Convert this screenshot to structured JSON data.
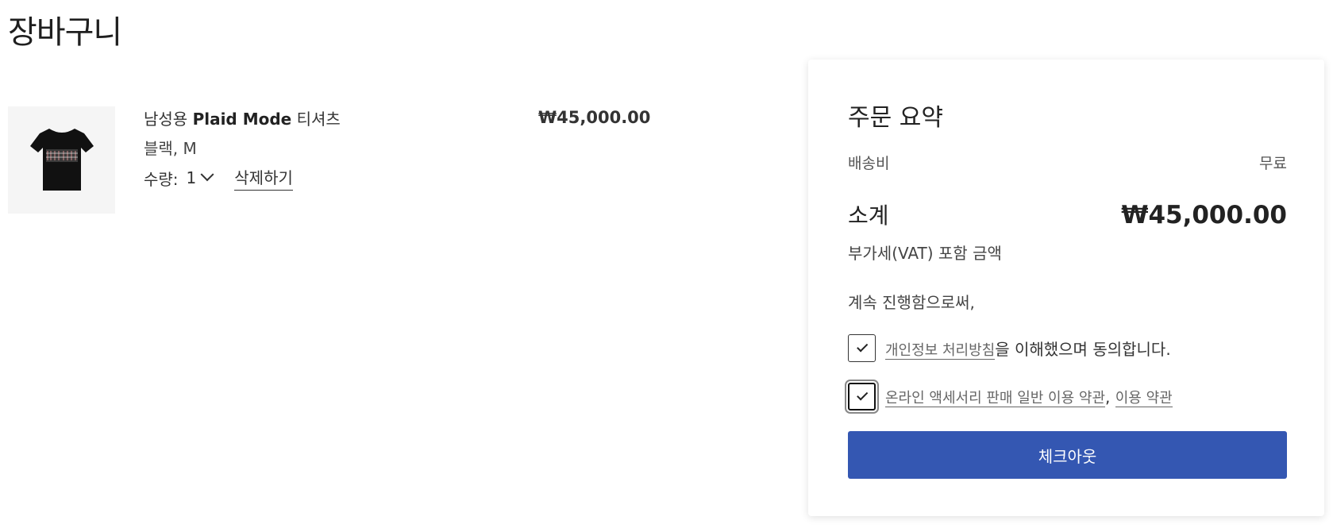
{
  "page": {
    "title": "장바구니"
  },
  "cart": {
    "items": [
      {
        "name_prefix": "남성용 ",
        "name_bold": "Plaid Mode",
        "name_suffix": " 티셔츠",
        "variant": "블랙, M",
        "qty_label": "수량:",
        "qty_value": "1",
        "delete_label": "삭제하기",
        "price": "₩45,000.00",
        "image_icon": "tshirt-black"
      }
    ]
  },
  "summary": {
    "title": "주문 요약",
    "shipping_label": "배송비",
    "shipping_value": "무료",
    "subtotal_label": "소계",
    "subtotal_value": "₩45,000.00",
    "vat_note": "부가세(VAT) 포함 금액",
    "continue_note": "계속 진행함으로써,",
    "agree1": {
      "link": "개인정보 처리방침",
      "text": "을 이해했으며 동의합니다.",
      "checked": true
    },
    "agree2": {
      "link1": "온라인 액세서리 판매 일반 이용 약관",
      "separator": ",",
      "link2": "이용 약관",
      "checked": true
    },
    "checkout_label": "체크아웃",
    "colors": {
      "button": "#3457b2",
      "button_text": "#ffffff"
    }
  }
}
